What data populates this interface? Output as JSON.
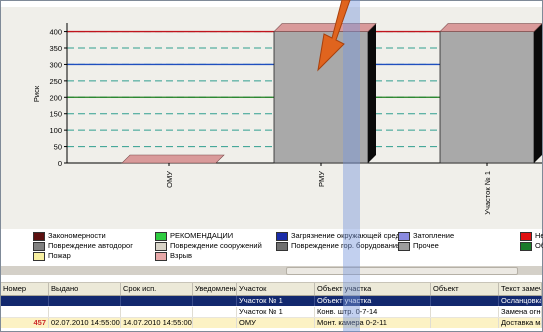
{
  "chart_data": {
    "type": "bar",
    "ylabel": "Риск",
    "yticks": [
      0,
      50,
      100,
      150,
      200,
      250,
      300,
      350,
      400
    ],
    "ylim": [
      0,
      420
    ],
    "categories": [
      "ОМУ",
      "РМУ",
      "Участок № 1"
    ],
    "values": [
      0,
      400,
      400
    ],
    "grid": true,
    "threshold_lines": [
      {
        "value": 400,
        "color": "#c0141c"
      },
      {
        "value": 300,
        "color": "#1f4fbf"
      },
      {
        "value": 200,
        "color": "#1f7f1f"
      }
    ],
    "colors": {
      "bar": "#a9a9a9",
      "bar_top": "#d99a9a",
      "bar_side": "#0a0a0a",
      "grid": "#2f9f8f",
      "background": "#f0efea"
    }
  },
  "legend": [
    {
      "label": "Закономерности",
      "color": "#5c1010"
    },
    {
      "label": "РЕКОМЕНДАЦИИ",
      "color": "#2ecc40"
    },
    {
      "label": "Загрязнение окружающей среды",
      "color": "#1a2ca8"
    },
    {
      "label": "Затопление",
      "color": "#8a8ae0"
    },
    {
      "label": "Не",
      "color": "#e01010"
    },
    {
      "label": "Повреждение автодорог",
      "color": "#808080"
    },
    {
      "label": "Повреждение сооружений",
      "color": "#d8d4c8"
    },
    {
      "label": "Повреждение гор. борудования",
      "color": "#707070"
    },
    {
      "label": "Прочее",
      "color": "#9c9c9c"
    },
    {
      "label": "Об",
      "color": "#1a7a2a"
    },
    {
      "label": "Пожар",
      "color": "#f8f0a0"
    },
    {
      "label": "Взрыв",
      "color": "#e8a8a8"
    }
  ],
  "table": {
    "columns": [
      "Номер",
      "Выдано",
      "Срок исп.",
      "Уведомление",
      "Участок",
      "Объект участка",
      "Объект",
      "Текст замечания"
    ],
    "rows": [
      [
        "",
        "",
        "",
        "",
        "Участок № 1",
        "Объект участка",
        "",
        "Осланцовка"
      ],
      [
        "",
        "",
        "",
        "",
        "Участок № 1",
        "Конв. штр. 0-7-14",
        "",
        "Замена огнет"
      ],
      [
        "457",
        "02.07.2010 14:55:00",
        "14.07.2010 14:55:00",
        "",
        "ОМУ",
        "Монт. камера 0-2-11",
        "",
        "Доставка ма"
      ]
    ]
  }
}
